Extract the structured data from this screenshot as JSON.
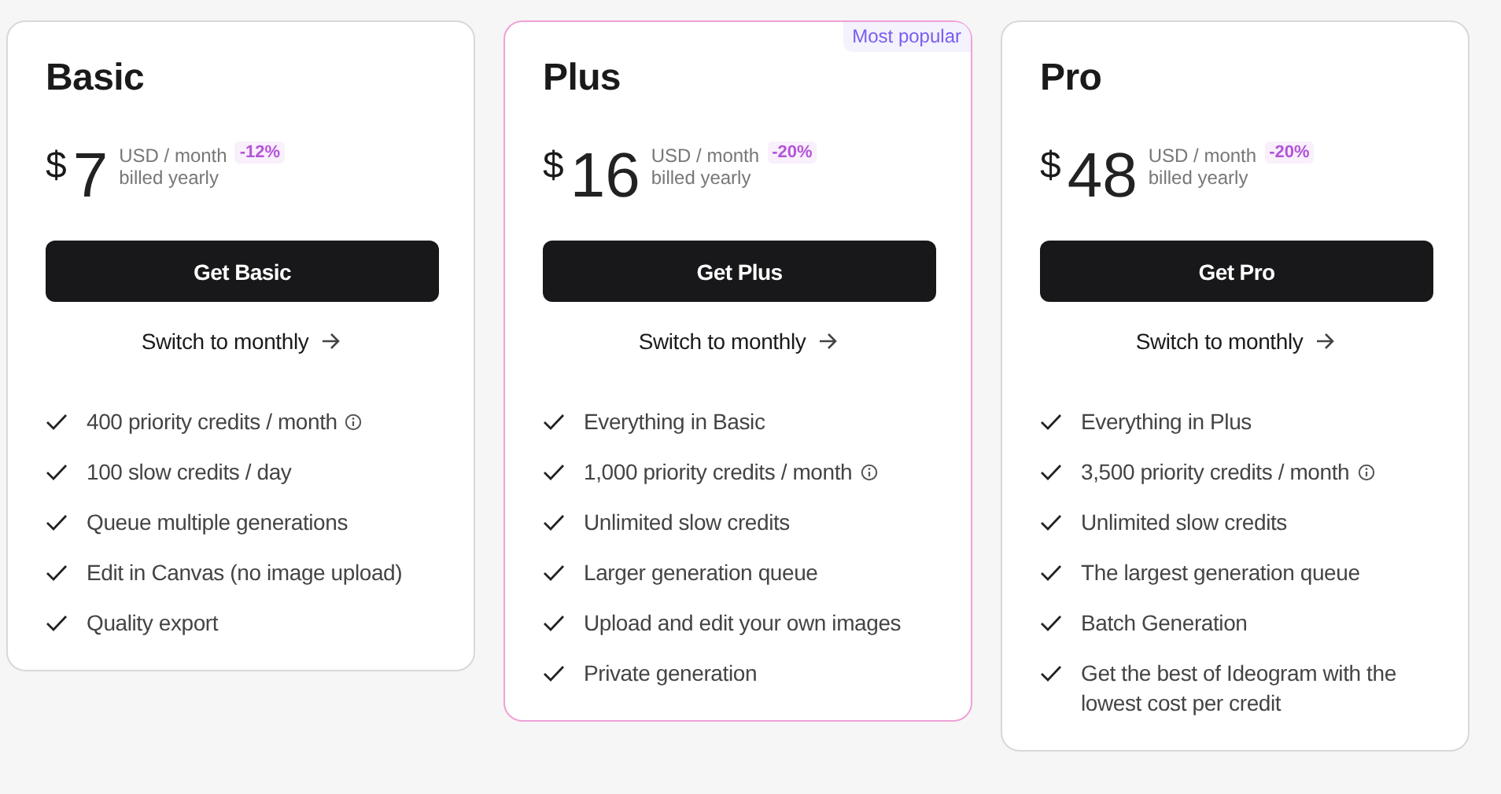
{
  "plans": [
    {
      "name": "Basic",
      "featured": false,
      "currency": "$",
      "price": "7",
      "period": "USD / month",
      "billing": "billed yearly",
      "discount": "-12%",
      "button": "Get Basic",
      "switch_link": "Switch to monthly",
      "features": [
        {
          "text": "400 priority credits / month",
          "info": true
        },
        {
          "text": "100 slow credits / day",
          "info": false
        },
        {
          "text": "Queue multiple generations",
          "info": false
        },
        {
          "text": "Edit in Canvas (no image upload)",
          "info": false
        },
        {
          "text": "Quality export",
          "info": false
        }
      ]
    },
    {
      "name": "Plus",
      "featured": true,
      "badge": "Most popular",
      "currency": "$",
      "price": "16",
      "period": "USD / month",
      "billing": "billed yearly",
      "discount": "-20%",
      "button": "Get Plus",
      "switch_link": "Switch to monthly",
      "features": [
        {
          "text": "Everything in Basic",
          "info": false
        },
        {
          "text": "1,000 priority credits / month",
          "info": true
        },
        {
          "text": "Unlimited slow credits",
          "info": false
        },
        {
          "text": "Larger generation queue",
          "info": false
        },
        {
          "text": "Upload and edit your own images",
          "info": false
        },
        {
          "text": "Private generation",
          "info": false
        }
      ]
    },
    {
      "name": "Pro",
      "featured": false,
      "currency": "$",
      "price": "48",
      "period": "USD / month",
      "billing": "billed yearly",
      "discount": "-20%",
      "button": "Get Pro",
      "switch_link": "Switch to monthly",
      "features": [
        {
          "text": "Everything in Plus",
          "info": false
        },
        {
          "text": "3,500 priority credits / month",
          "info": true
        },
        {
          "text": "Unlimited slow credits",
          "info": false
        },
        {
          "text": "The largest generation queue",
          "info": false
        },
        {
          "text": "Batch Generation",
          "info": false
        },
        {
          "text": "Get the best of Ideogram with the lowest cost per credit",
          "info": false
        }
      ]
    }
  ]
}
